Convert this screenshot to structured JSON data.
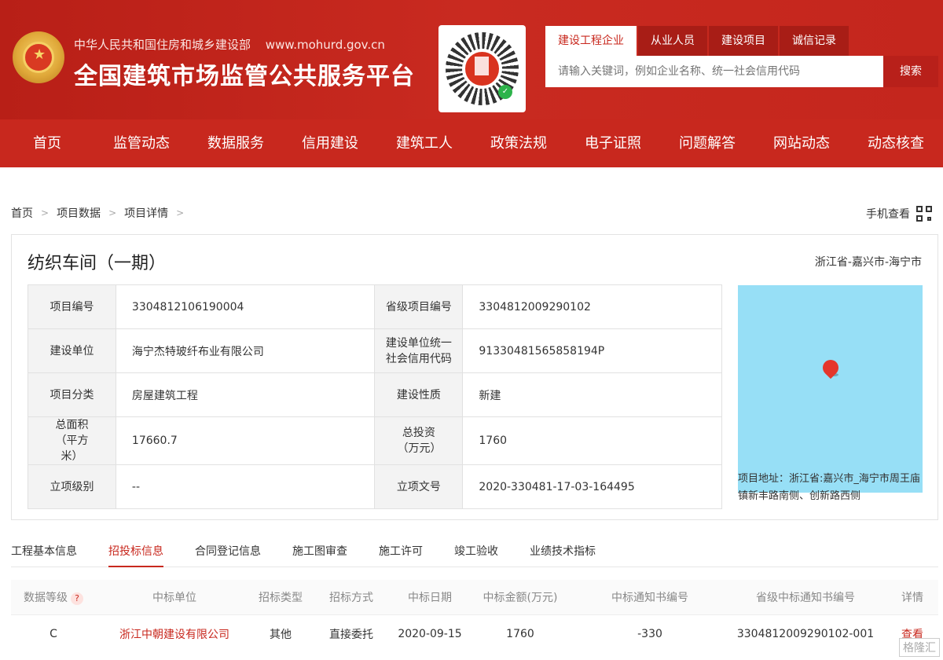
{
  "header": {
    "ministry": "中华人民共和国住房和城乡建设部",
    "url": "www.mohurd.gov.cn",
    "platform_title": "全国建筑市场监管公共服务平台",
    "search_tabs": [
      "建设工程企业",
      "从业人员",
      "建设项目",
      "诚信记录"
    ],
    "search_placeholder": "请输入关键词，例如企业名称、统一社会信用代码",
    "search_button": "搜索"
  },
  "nav": [
    "首页",
    "监管动态",
    "数据服务",
    "信用建设",
    "建筑工人",
    "政策法规",
    "电子证照",
    "问题解答",
    "网站动态",
    "动态核查"
  ],
  "breadcrumb": [
    "首页",
    "项目数据",
    "项目详情"
  ],
  "mobile_view": "手机查看",
  "project": {
    "title": "纺织车间（一期）",
    "location": "浙江省-嘉兴市-海宁市",
    "rows": [
      {
        "k1": "项目编号",
        "v1": "3304812106190004",
        "k2": "省级项目编号",
        "v2": "3304812009290102"
      },
      {
        "k1": "建设单位",
        "v1": "海宁杰特玻纤布业有限公司",
        "k2": "建设单位统一社会信用代码",
        "v2": "91330481565858194P"
      },
      {
        "k1": "项目分类",
        "v1": "房屋建筑工程",
        "k2": "建设性质",
        "v2": "新建"
      },
      {
        "k1": "总面积（平方米）",
        "v1": "17660.7",
        "k2": "总投资（万元）",
        "v2": "1760"
      },
      {
        "k1": "立项级别",
        "v1": "--",
        "k2": "立项文号",
        "v2": "2020-330481-17-03-164495"
      }
    ],
    "address": "项目地址：浙江省:嘉兴市_海宁市周王庙镇新丰路南侧、创新路西侧"
  },
  "subtabs": [
    "工程基本信息",
    "招投标信息",
    "合同登记信息",
    "施工图审查",
    "施工许可",
    "竣工验收",
    "业绩技术指标"
  ],
  "active_subtab": "招投标信息",
  "bid_table": {
    "headers": [
      "数据等级",
      "中标单位",
      "招标类型",
      "招标方式",
      "中标日期",
      "中标金额(万元)",
      "中标通知书编号",
      "省级中标通知书编号",
      "详情"
    ],
    "rows": [
      {
        "level": "C",
        "winner": "浙江中朝建设有限公司",
        "type": "其他",
        "method": "直接委托",
        "date": "2020-09-15",
        "amount": "1760",
        "notice_no": "-330",
        "prov_notice_no": "3304812009290102-001",
        "detail": "查看"
      }
    ]
  },
  "watermark": "格隆汇",
  "colors": {
    "brand_red": "#c8281e",
    "map_water": "#97dff6"
  }
}
